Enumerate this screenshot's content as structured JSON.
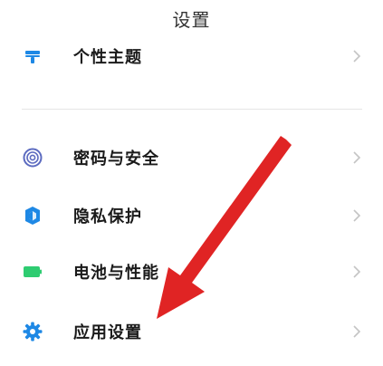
{
  "header": {
    "title": "设置"
  },
  "settings": {
    "items": [
      {
        "label": "个性主题",
        "icon": "theme-icon",
        "color": "#1e88e5"
      },
      {
        "label": "密码与安全",
        "icon": "fingerprint-icon",
        "color": "#5c6bc0"
      },
      {
        "label": "隐私保护",
        "icon": "privacy-shield-icon",
        "color": "#1e88e5"
      },
      {
        "label": "电池与性能",
        "icon": "battery-icon",
        "color": "#2ecc71"
      },
      {
        "label": "应用设置",
        "icon": "gear-icon",
        "color": "#1e88e5"
      }
    ]
  },
  "annotation": {
    "arrow_color": "#e02424"
  }
}
